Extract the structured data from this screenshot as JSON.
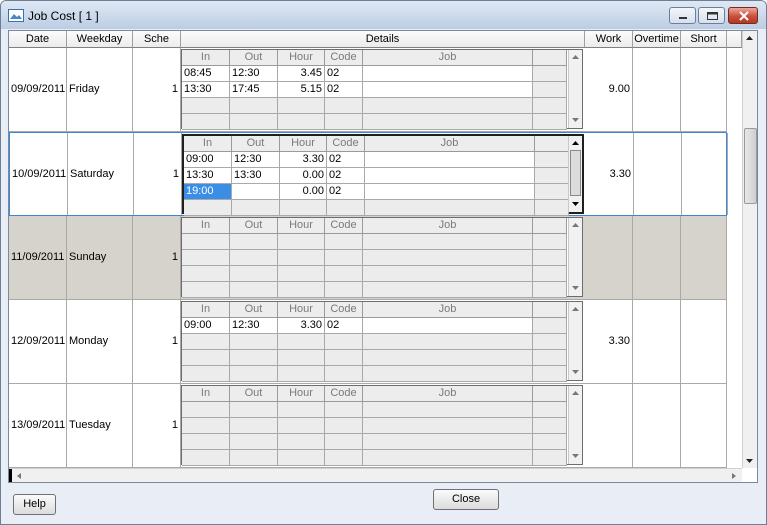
{
  "window": {
    "title": "Job Cost   [ 1 ]"
  },
  "columns": {
    "date": "Date",
    "weekday": "Weekday",
    "sche": "Sche",
    "details": "Details",
    "work": "Work",
    "overtime": "Overtime",
    "short": "Short"
  },
  "details_columns": {
    "in": "In",
    "out": "Out",
    "hour": "Hour",
    "code": "Code",
    "job": "Job"
  },
  "rows": [
    {
      "date": "09/09/2011",
      "weekday": "Friday",
      "sche": "1",
      "work": "9.00",
      "overtime": "",
      "short": "",
      "entries": [
        {
          "in": "08:45",
          "out": "12:30",
          "hour": "3.45",
          "code": "02",
          "job": ""
        },
        {
          "in": "13:30",
          "out": "17:45",
          "hour": "5.15",
          "code": "02",
          "job": ""
        }
      ]
    },
    {
      "date": "10/09/2011",
      "weekday": "Saturday",
      "sche": "1",
      "work": "3.30",
      "overtime": "",
      "short": "",
      "entries": [
        {
          "in": "09:00",
          "out": "12:30",
          "hour": "3.30",
          "code": "02",
          "job": ""
        },
        {
          "in": "13:30",
          "out": "13:30",
          "hour": "0.00",
          "code": "02",
          "job": ""
        },
        {
          "in": "19:00",
          "out": "",
          "hour": "0.00",
          "code": "02",
          "job": ""
        }
      ]
    },
    {
      "date": "11/09/2011",
      "weekday": "Sunday",
      "sche": "1",
      "work": "",
      "overtime": "",
      "short": "",
      "entries": []
    },
    {
      "date": "12/09/2011",
      "weekday": "Monday",
      "sche": "1",
      "work": "3.30",
      "overtime": "",
      "short": "",
      "entries": [
        {
          "in": "09:00",
          "out": "12:30",
          "hour": "3.30",
          "code": "02",
          "job": ""
        }
      ]
    },
    {
      "date": "13/09/2011",
      "weekday": "Tuesday",
      "sche": "1",
      "work": "",
      "overtime": "",
      "short": "",
      "entries": []
    }
  ],
  "buttons": {
    "help": "Help",
    "close": "Close"
  },
  "colors": {
    "selection": "#3b8ee6",
    "sunday_row": "#d6d3cc",
    "close_button": "#c9503c"
  }
}
